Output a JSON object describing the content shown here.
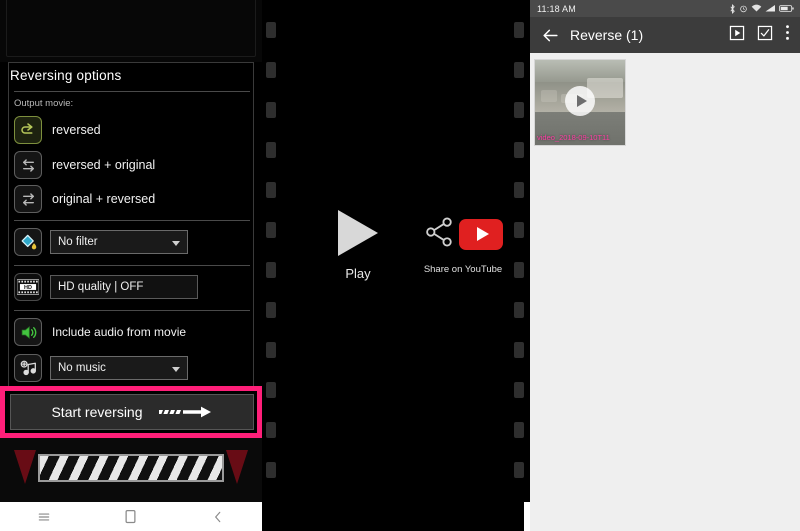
{
  "left_panel": {
    "card_title": "Reversing options",
    "sub_label": "Output movie:",
    "output_options": [
      {
        "label": "reversed",
        "icon": "loop-reverse-icon",
        "selected": true
      },
      {
        "label": "reversed + original",
        "icon": "reverse-then-forward-icon",
        "selected": false
      },
      {
        "label": "original + reversed",
        "icon": "forward-then-reverse-icon",
        "selected": false
      }
    ],
    "filter": {
      "icon": "paint-bucket-icon",
      "value": "No filter"
    },
    "hd": {
      "icon": "hd-film-icon",
      "label": "HD quality | OFF"
    },
    "audio": {
      "icon": "speaker-icon",
      "label": "Include audio from movie"
    },
    "music": {
      "icon": "add-music-note-icon",
      "value": "No music"
    },
    "start_button": {
      "label": "Start reversing",
      "icon": "arrow-right-icon"
    },
    "highlight_color": "#ff1f79"
  },
  "middle_panel": {
    "play": {
      "label": "Play",
      "icon": "play-triangle-icon"
    },
    "share": {
      "label": "Share on YouTube",
      "icon": "share-nodes-icon",
      "badge_icon": "youtube-icon",
      "badge_color": "#e02020"
    }
  },
  "right_panel": {
    "status_bar": {
      "time": "11:18 AM",
      "icons": [
        "bluetooth-icon",
        "alarm-icon",
        "wifi-icon",
        "signal-icon",
        "battery-icon"
      ]
    },
    "app_bar": {
      "back_icon": "back-arrow-icon",
      "title": "Reverse (1)",
      "actions": [
        "play-box-icon",
        "checkbox-icon",
        "overflow-menu-icon"
      ]
    },
    "items": [
      {
        "name": "video_2018-09-10T11",
        "overlay_icon": "play-circle-icon",
        "name_color": "#ff3ea5"
      }
    ],
    "background_color": "#efefef"
  },
  "nav_bars": {
    "icons": [
      "recents-icon",
      "home-icon",
      "back-icon"
    ]
  }
}
